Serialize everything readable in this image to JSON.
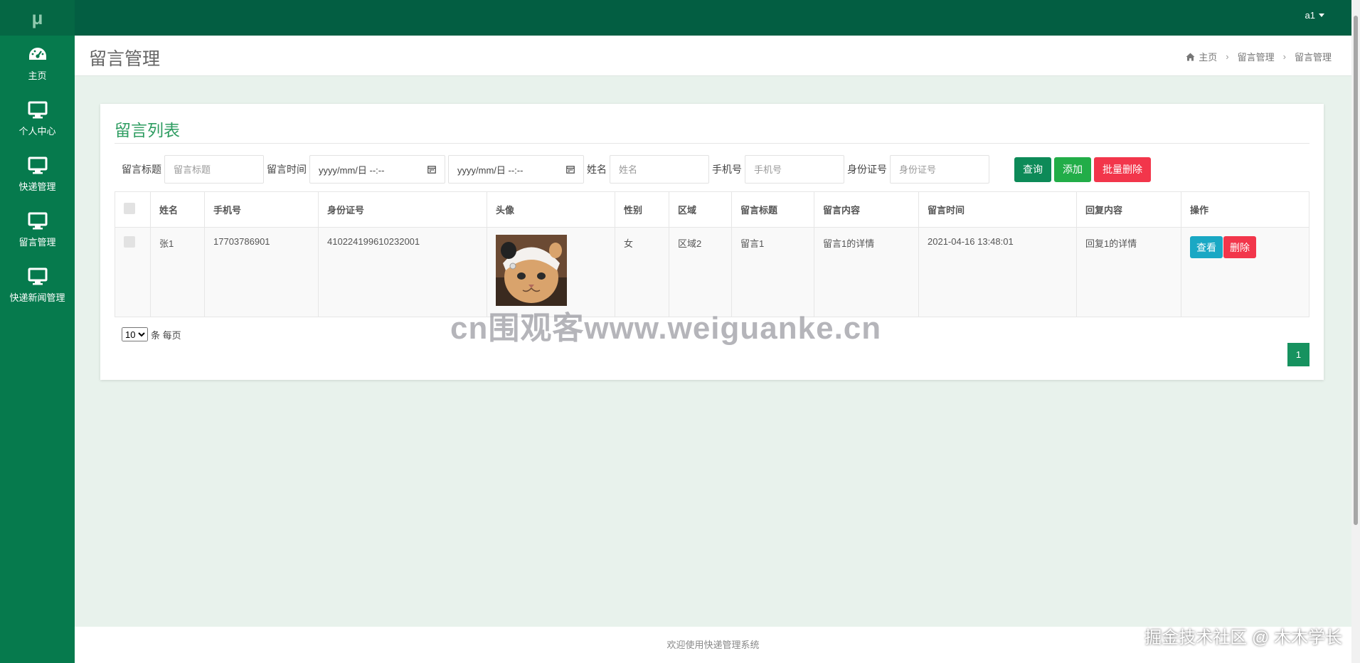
{
  "logo": "μ",
  "sidebar": {
    "items": [
      {
        "label": "主页",
        "icon": "dashboard-icon"
      },
      {
        "label": "个人中心",
        "icon": "monitor-icon"
      },
      {
        "label": "快递管理",
        "icon": "monitor-icon"
      },
      {
        "label": "留言管理",
        "icon": "monitor-icon"
      },
      {
        "label": "快递新闻管理",
        "icon": "monitor-icon"
      }
    ]
  },
  "topbar": {
    "user": "a1"
  },
  "header": {
    "title": "留言管理",
    "breadcrumb": [
      "主页",
      "留言管理",
      "留言管理"
    ]
  },
  "card": {
    "title": "留言列表",
    "search": {
      "title_label": "留言标题",
      "title_placeholder": "留言标题",
      "time_label": "留言时间",
      "date_placeholder": "yyyy/mm/日 --:--",
      "name_label": "姓名",
      "name_placeholder": "姓名",
      "phone_label": "手机号",
      "phone_placeholder": "手机号",
      "id_label": "身份证号",
      "id_placeholder": "身份证号",
      "query_btn": "查询",
      "add_btn": "添加",
      "batch_delete_btn": "批量删除"
    },
    "table": {
      "columns": [
        "姓名",
        "手机号",
        "身份证号",
        "头像",
        "性别",
        "区域",
        "留言标题",
        "留言内容",
        "留言时间",
        "回复内容",
        "操作"
      ],
      "rows": [
        {
          "name": "张1",
          "phone": "17703786901",
          "id_number": "410224199610232001",
          "gender": "女",
          "area": "区域2",
          "title": "留言1",
          "content": "留言1的详情",
          "time": "2021-04-16 13:48:01",
          "reply": "回复1的详情",
          "view_btn": "查看",
          "delete_btn": "删除"
        }
      ]
    },
    "page_size": "10",
    "page_size_suffix": "条 每页",
    "current_page": "1"
  },
  "watermark": "cn围观客www.weiguanke.cn",
  "footer": "欢迎使用快递管理系统",
  "footer_watermark": "掘金技术社区 @ 木木学长",
  "colors": {
    "sidebar": "#067a4d",
    "topbar": "#035e42",
    "accent": "#2e9d61",
    "danger": "#f2364b",
    "info": "#1aa8c4"
  }
}
